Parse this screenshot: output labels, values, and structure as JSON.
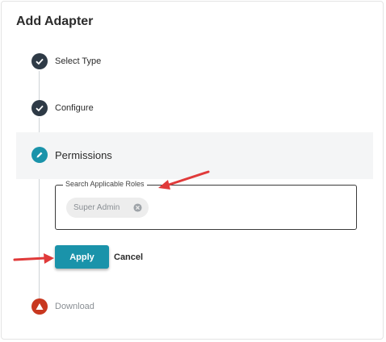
{
  "dialog": {
    "title": "Add Adapter"
  },
  "steps": [
    {
      "label": "Select Type",
      "status": "done",
      "icon": "check-icon"
    },
    {
      "label": "Configure",
      "status": "done",
      "icon": "check-icon"
    },
    {
      "label": "Permissions",
      "status": "active",
      "icon": "pencil-icon"
    },
    {
      "label": "Download",
      "status": "error",
      "icon": "warning-icon"
    }
  ],
  "permissions": {
    "field_label": "Search Applicable Roles",
    "chips": [
      {
        "label": "Super Admin"
      }
    ],
    "apply_label": "Apply",
    "cancel_label": "Cancel"
  },
  "colors": {
    "accent": "#1a93aa",
    "done": "#2e3a46",
    "error": "#c8371f",
    "annotation_arrow": "#e03a3a"
  }
}
